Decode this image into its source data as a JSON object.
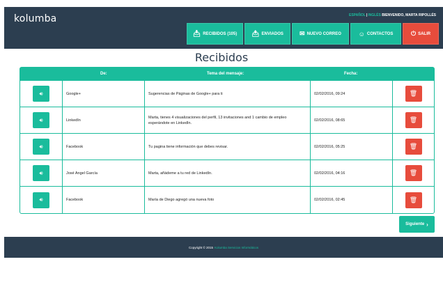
{
  "header": {
    "logo": "kolumba",
    "lang_es": "ESPAÑOL",
    "lang_sep": "|",
    "lang_en": "INGLÉS",
    "welcome": "BIENVENIDO, MARTA RIPOLLÉS"
  },
  "nav": {
    "inbox": "RECIBIDOS (105)",
    "sent": "ENVIADOS",
    "new_mail": "NUEVO CORREO",
    "contacts": "CONTACTOS",
    "logout": "SALIR"
  },
  "page_title": "Recibidos",
  "table": {
    "headers": {
      "from": "De:",
      "subject": "Tema del mensaje:",
      "date": "Fecha:"
    },
    "rows": [
      {
        "from": "Google+",
        "subject": "Sugerencias de Páginas de Google+ para ti",
        "date": "02/02/2016, 09:24"
      },
      {
        "from": "LinkedIn",
        "subject": "Marta, tienes 4 visualizaciones del perfil, 13 invitaciones and 1 cambio de empleo esperándote en LinkedIn.",
        "date": "02/02/2016, 08:65"
      },
      {
        "from": "Facebook",
        "subject": "Tu pagina tiene información que debes revisar.",
        "date": "02/02/2016, 05:25"
      },
      {
        "from": "José Angel García",
        "subject": "Marta, añádeme a tu red de LinkedIn.",
        "date": "02/02/2016, 04:16"
      },
      {
        "from": "Facebook",
        "subject": "María de Diego agregó una nueva foto",
        "date": "02/02/2016, 02:45"
      }
    ]
  },
  "pagination": {
    "next": "Siguiente"
  },
  "footer": {
    "copyright": "Copyright © 2015",
    "company": "Kolumba Servicios Informáticos"
  },
  "colors": {
    "accent": "#1abc9c",
    "danger": "#e74c3c",
    "dark": "#2c3e50"
  }
}
